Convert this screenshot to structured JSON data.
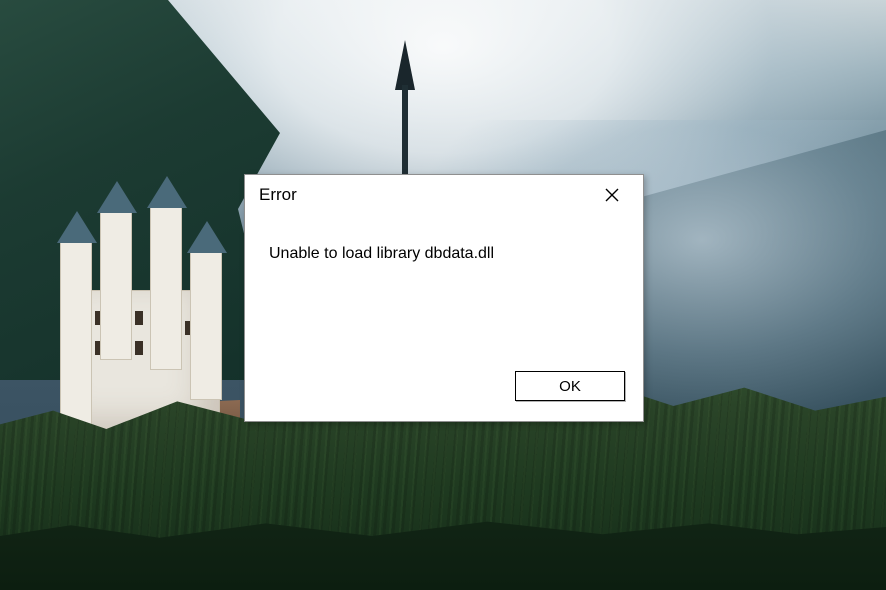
{
  "dialog": {
    "title": "Error",
    "message": "Unable to load library dbdata.dll",
    "ok_label": "OK"
  }
}
